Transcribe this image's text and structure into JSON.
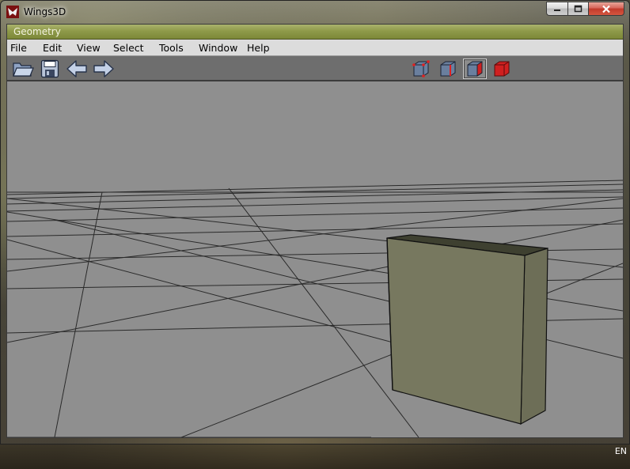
{
  "window": {
    "title": "Wings3D",
    "controls": {
      "minimize": "minimize",
      "maximize": "maximize",
      "close": "close"
    }
  },
  "geometry_panel": {
    "title": "Geometry"
  },
  "menubar": {
    "items": [
      "File",
      "Edit",
      "View",
      "Select",
      "Tools",
      "Window",
      "Help"
    ]
  },
  "toolbar": {
    "left_icons": [
      "open-folder-icon",
      "save-disk-icon",
      "undo-arrow-icon",
      "redo-arrow-icon"
    ],
    "selection_modes": [
      "vertex-mode",
      "edge-mode",
      "face-mode",
      "body-mode"
    ],
    "active_mode": "face-mode"
  },
  "viewport": {
    "background": "#8f8f8f",
    "grid_color": "#2a2a2a",
    "object": {
      "kind": "cube",
      "face_color": "#77785f",
      "top_color": "#3e4030"
    }
  },
  "taskbar": {
    "language": "EN"
  },
  "colors": {
    "geometry_bar": "#8f9a4a",
    "menubar": "#dcdcdc",
    "toolbar": "#6e6e6e",
    "selection_red": "#d02020"
  }
}
